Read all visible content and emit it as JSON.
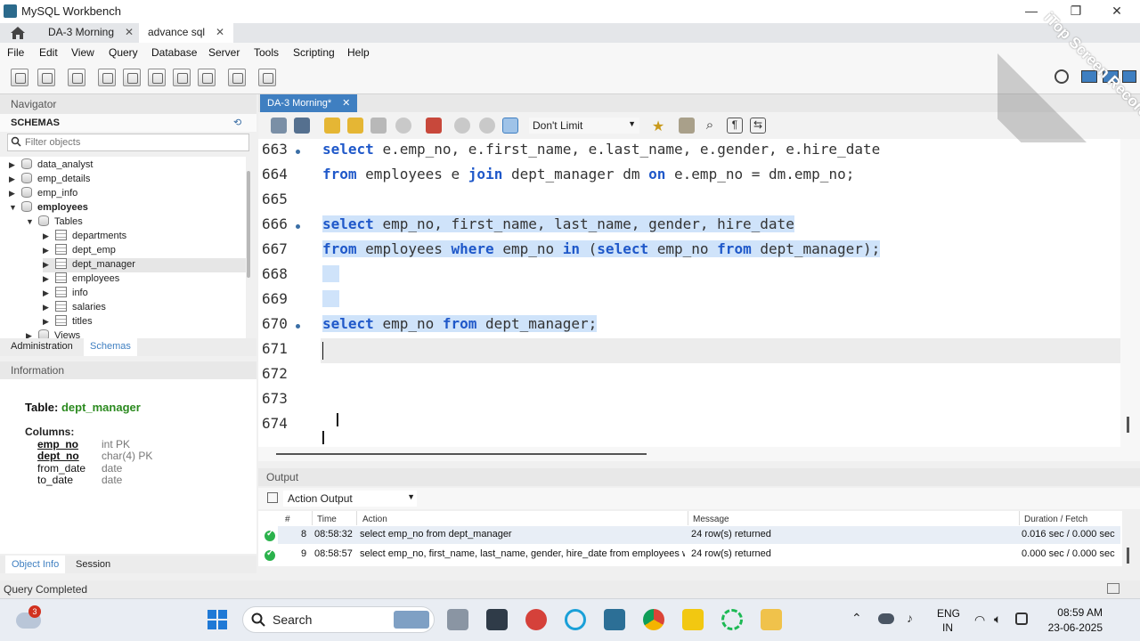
{
  "window": {
    "title": "MySQL Workbench"
  },
  "connection_tabs": [
    {
      "label": "DA-3 Morning"
    },
    {
      "label": "advance sql"
    }
  ],
  "menu": [
    "File",
    "Edit",
    "View",
    "Query",
    "Database",
    "Server",
    "Tools",
    "Scripting",
    "Help"
  ],
  "navigator": {
    "title": "Navigator",
    "schemas_label": "SCHEMAS",
    "filter_placeholder": "Filter objects",
    "tree": [
      {
        "label": "data_analyst",
        "level": 0,
        "type": "schema",
        "expanded": false
      },
      {
        "label": "emp_details",
        "level": 0,
        "type": "schema",
        "expanded": false
      },
      {
        "label": "emp_info",
        "level": 0,
        "type": "schema",
        "expanded": false
      },
      {
        "label": "employees",
        "level": 0,
        "type": "schema",
        "expanded": true,
        "bold": true
      },
      {
        "label": "Tables",
        "level": 1,
        "type": "folder",
        "expanded": true
      },
      {
        "label": "departments",
        "level": 2,
        "type": "table",
        "expanded": false
      },
      {
        "label": "dept_emp",
        "level": 2,
        "type": "table",
        "expanded": false
      },
      {
        "label": "dept_manager",
        "level": 2,
        "type": "table",
        "expanded": false,
        "selected": true
      },
      {
        "label": "employees",
        "level": 2,
        "type": "table",
        "expanded": false
      },
      {
        "label": "info",
        "level": 2,
        "type": "table",
        "expanded": false
      },
      {
        "label": "salaries",
        "level": 2,
        "type": "table",
        "expanded": false
      },
      {
        "label": "titles",
        "level": 2,
        "type": "table",
        "expanded": false
      },
      {
        "label": "Views",
        "level": 1,
        "type": "folder",
        "expanded": false
      }
    ],
    "tabs": [
      {
        "label": "Administration",
        "active": false
      },
      {
        "label": "Schemas",
        "active": true
      }
    ]
  },
  "information": {
    "title": "Information",
    "table_label": "Table:",
    "table_name": "dept_manager",
    "columns_label": "Columns:",
    "columns": [
      {
        "name": "emp_no",
        "type": "int PK",
        "pk": true
      },
      {
        "name": "dept_no",
        "type": "char(4) PK",
        "pk": true
      },
      {
        "name": "from_date",
        "type": "date",
        "pk": false
      },
      {
        "name": "to_date",
        "type": "date",
        "pk": false
      }
    ],
    "tabs": [
      {
        "label": "Object Info",
        "active": true
      },
      {
        "label": "Session",
        "active": false
      }
    ]
  },
  "editor": {
    "tab_label": "DA-3 Morning*",
    "limit": "Don't Limit",
    "lines": [
      {
        "num": "663",
        "dot": true,
        "selected": false,
        "code": "select e.emp_no, e.first_name, e.last_name, e.gender, e.hire_date"
      },
      {
        "num": "664",
        "dot": false,
        "selected": false,
        "code": "from employees e join dept_manager dm on e.emp_no = dm.emp_no;"
      },
      {
        "num": "665",
        "dot": false,
        "selected": false,
        "code": ""
      },
      {
        "num": "666",
        "dot": true,
        "selected": true,
        "code": "select emp_no, first_name, last_name, gender, hire_date"
      },
      {
        "num": "667",
        "dot": false,
        "selected": true,
        "code": "from employees where emp_no in (select emp_no from dept_manager);"
      },
      {
        "num": "668",
        "dot": false,
        "selected": true,
        "code": ""
      },
      {
        "num": "669",
        "dot": false,
        "selected": true,
        "code": ""
      },
      {
        "num": "670",
        "dot": true,
        "selected": true,
        "code": "select emp_no from dept_manager;"
      },
      {
        "num": "671",
        "dot": false,
        "selected": false,
        "code": ""
      },
      {
        "num": "672",
        "dot": false,
        "selected": false,
        "code": ""
      },
      {
        "num": "673",
        "dot": false,
        "selected": false,
        "code": ""
      },
      {
        "num": "674",
        "dot": false,
        "selected": false,
        "code": ""
      }
    ],
    "keywords": [
      "select",
      "from",
      "join",
      "on",
      "where",
      "in"
    ]
  },
  "output": {
    "title": "Output",
    "type": "Action Output",
    "columns": [
      "#",
      "Time",
      "Action",
      "Message",
      "Duration / Fetch"
    ],
    "rows": [
      {
        "num": "8",
        "time": "08:58:32",
        "action": "select emp_no from dept_manager",
        "message": "24 row(s) returned",
        "duration": "0.016 sec / 0.000 sec"
      },
      {
        "num": "9",
        "time": "08:58:57",
        "action": "select emp_no, first_name, last_name, gender, hire_date from employees w...",
        "message": "24 row(s) returned",
        "duration": "0.000 sec / 0.000 sec"
      }
    ]
  },
  "status": {
    "text": "Query Completed"
  },
  "taskbar": {
    "search_label": "Search",
    "weather_badge": "3",
    "lang_top": "ENG",
    "lang_bottom": "IN",
    "time": "08:59 AM",
    "date": "23-06-2025"
  },
  "watermark": {
    "text": "iTop Screen Recorder"
  },
  "colors": {
    "accent": "#3f7fc1",
    "keyword": "#1f58c9",
    "selection": "#cfe3fa",
    "table_name": "#2b8a1f"
  }
}
